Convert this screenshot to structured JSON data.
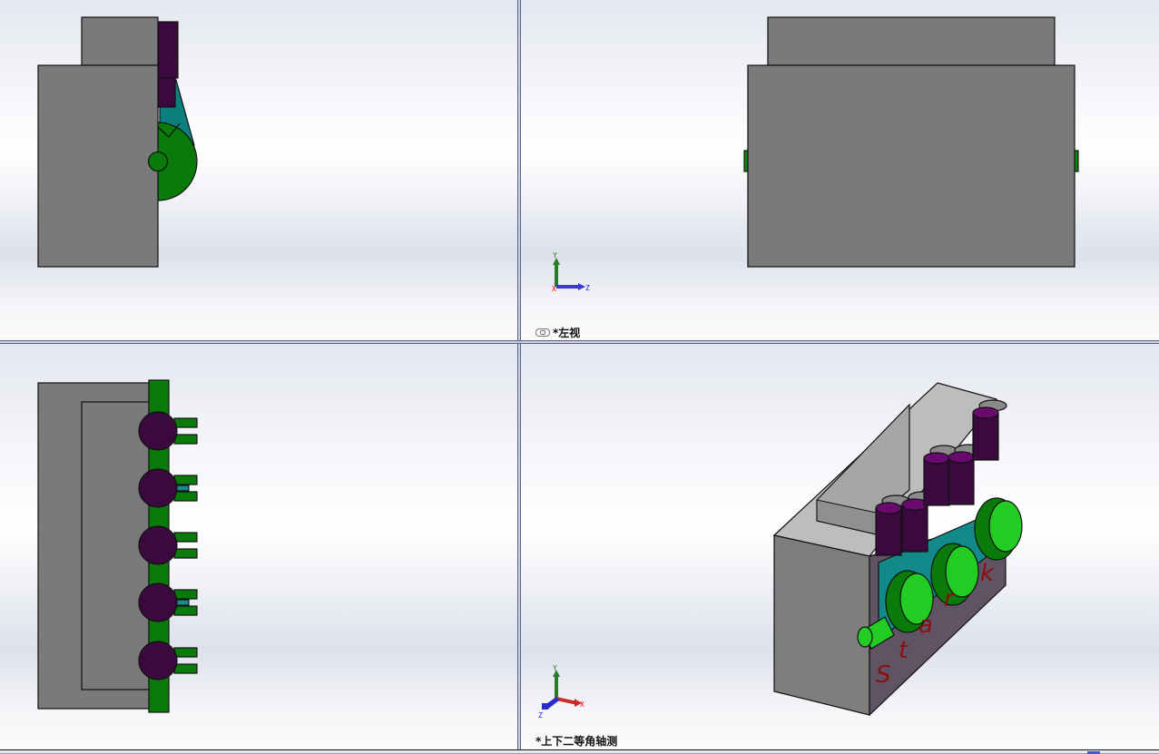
{
  "viewports": [
    {
      "id": "top-left",
      "label": ""
    },
    {
      "id": "top-right",
      "label": "*左视",
      "linked": true
    },
    {
      "id": "bottom-left",
      "label": ""
    },
    {
      "id": "bottom-right",
      "label": "*上下二等角轴测"
    }
  ],
  "triad": {
    "x": "X",
    "y": "Y",
    "z": "Z"
  },
  "model": {
    "engraved_text": [
      "S",
      "t",
      "a",
      "r",
      "k"
    ],
    "colors": {
      "block": "#7a7a7a",
      "block_light": "#b4b4b4",
      "block_side": "#5f5364",
      "piston": "#3a0a3e",
      "piston_top": "#6a0a70",
      "connecting_rod": "#1a8a8a",
      "crankshaft": "#0a7a0a",
      "crankshaft_light": "#22cc22",
      "lettering": "#8a1010"
    }
  }
}
